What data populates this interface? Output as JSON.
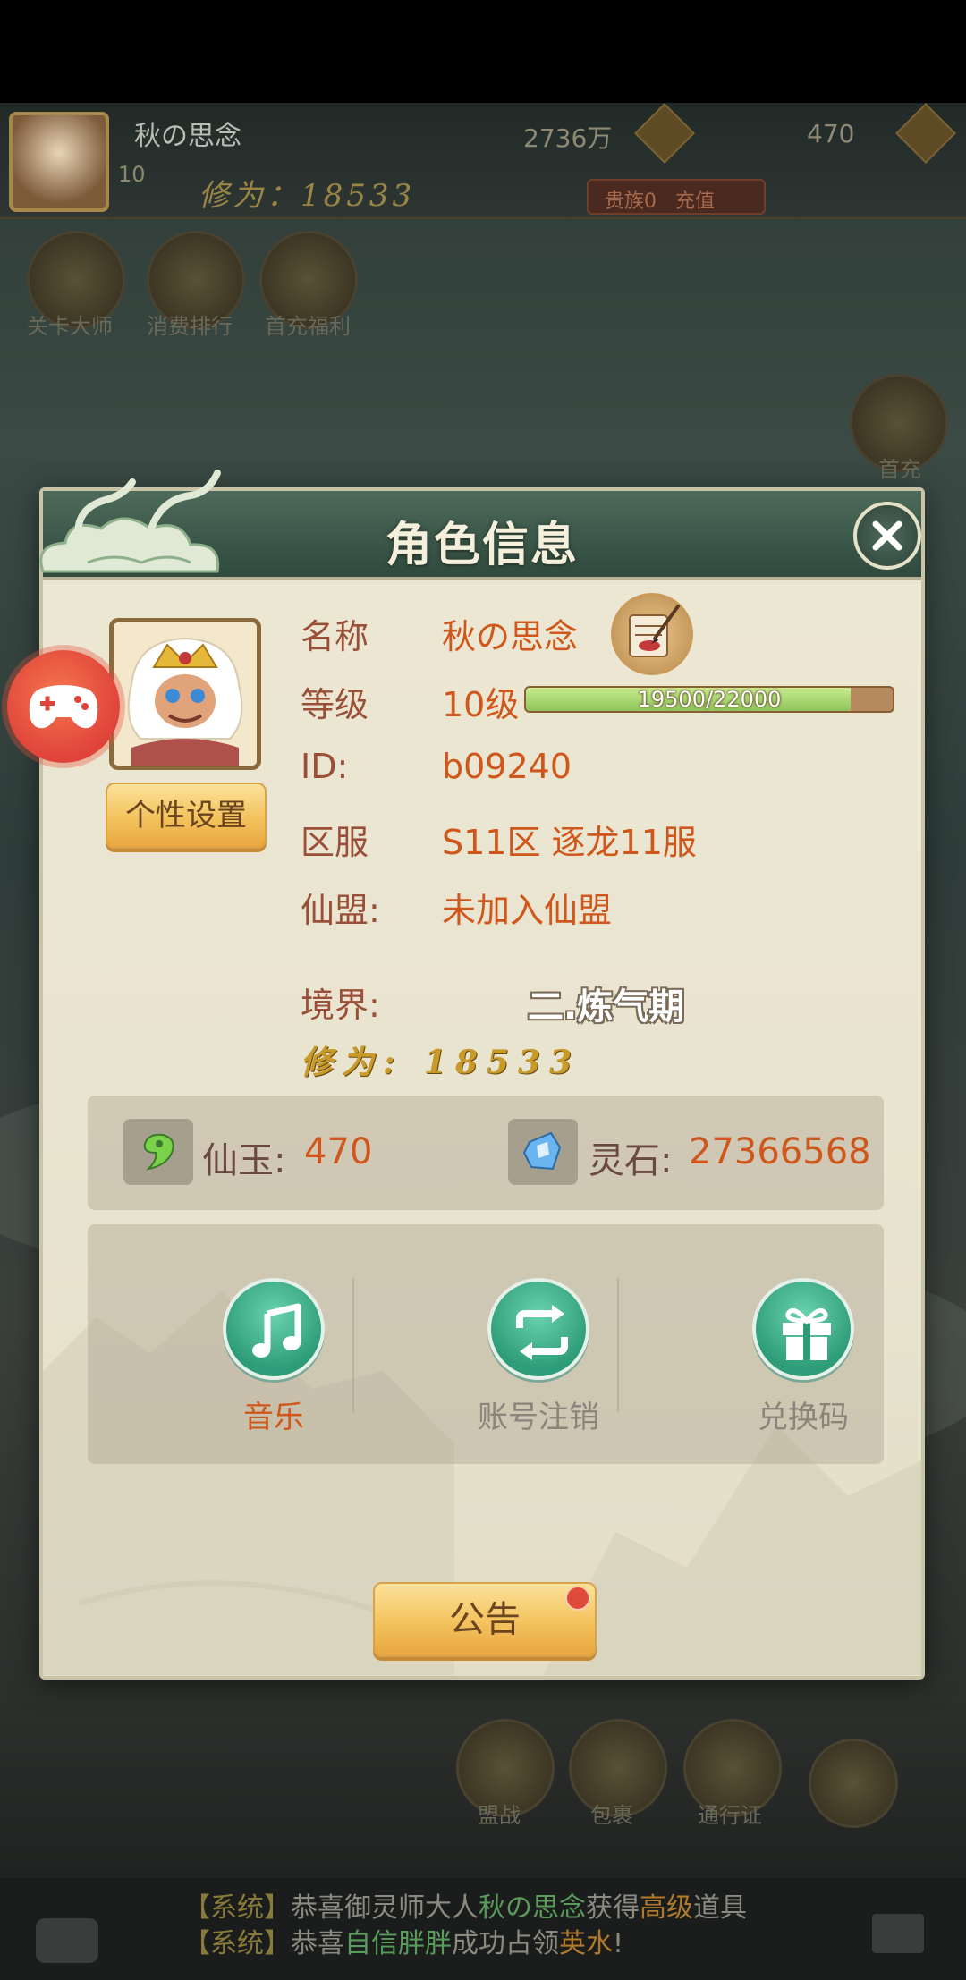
{
  "topbar": {
    "player_name": "秋の思念",
    "level": "10",
    "cultivation": "修为：18533",
    "stone_amount": "2736万",
    "jade_amount": "470",
    "vip_label": "贵族0",
    "recharge_label": "充值"
  },
  "scene_buttons": [
    "关卡大师",
    "消费排行",
    "首充福利",
    "首充"
  ],
  "bottom_buttons": [
    "盟战",
    "包裹",
    "通行证"
  ],
  "chat": {
    "lines": [
      {
        "tag": "【系统】",
        "pre": "恭喜御灵师大人",
        "name": "秋の思念",
        "mid": "获得",
        "item": "高级",
        "post": "道具"
      },
      {
        "tag": "【系统】",
        "pre": "恭喜",
        "name": "自信胖胖",
        "mid": "成功占领",
        "item": "英水",
        "post": "!"
      }
    ]
  },
  "modal": {
    "title": "角色信息",
    "customize_button": "个性设置",
    "rows": {
      "name_label": "名称",
      "name_value": "秋の思念",
      "level_label": "等级",
      "level_value": "10级",
      "xp_text": "19500/22000",
      "id_label": "ID:",
      "id_value": "b09240",
      "server_label": "区服",
      "server_value": "S11区 逐龙11服",
      "alliance_label": "仙盟:",
      "alliance_value": "未加入仙盟",
      "realm_label": "境界:",
      "realm_value": "二.炼气期",
      "cultivation_text": "修为: 18533"
    },
    "xp_fraction": 0.886,
    "currency": {
      "jade_label": "仙玉:",
      "jade_value": "470",
      "stone_label": "灵石:",
      "stone_value": "27366568"
    },
    "settings": [
      {
        "label": "音乐",
        "icon": "music-icon",
        "color": "#d0571c"
      },
      {
        "label": "账号注销",
        "icon": "refresh-icon",
        "color": "#8a847a"
      },
      {
        "label": "兑换码",
        "icon": "gift-icon",
        "color": "#8a847a"
      }
    ],
    "notice_button": "公告"
  },
  "colors": {
    "accent_orange": "#d0571c",
    "label_brown": "#9a5038",
    "teal_button": "#2e9c78",
    "header_green": "#2f4a3e"
  }
}
